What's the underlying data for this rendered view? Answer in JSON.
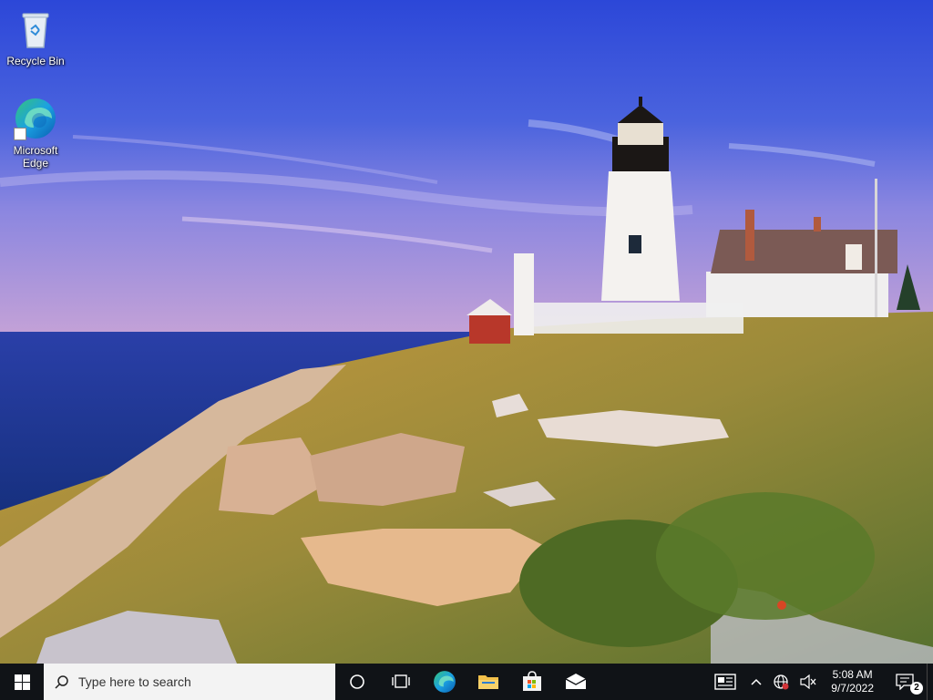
{
  "desktop": {
    "icons": [
      {
        "label": "Recycle Bin",
        "icon": "recycle-bin-icon"
      },
      {
        "label": "Microsoft Edge",
        "icon": "edge-icon"
      }
    ]
  },
  "taskbar": {
    "search_placeholder": "Type here to search",
    "pinned": [
      {
        "name": "cortana",
        "icon": "cortana-circle-icon"
      },
      {
        "name": "task-view",
        "icon": "task-view-icon"
      },
      {
        "name": "edge",
        "icon": "edge-icon"
      },
      {
        "name": "file-explorer",
        "icon": "folder-icon"
      },
      {
        "name": "microsoft-store",
        "icon": "store-icon"
      },
      {
        "name": "mail",
        "icon": "mail-icon"
      }
    ],
    "tray": {
      "clock_time": "5:08 AM",
      "clock_date": "9/7/2022",
      "notification_count": "2"
    }
  },
  "colors": {
    "taskbar_bg": "#101317",
    "search_bg": "#f3f3f3",
    "sky_top": "#2b4fd6",
    "sea": "#1d3f9a"
  }
}
